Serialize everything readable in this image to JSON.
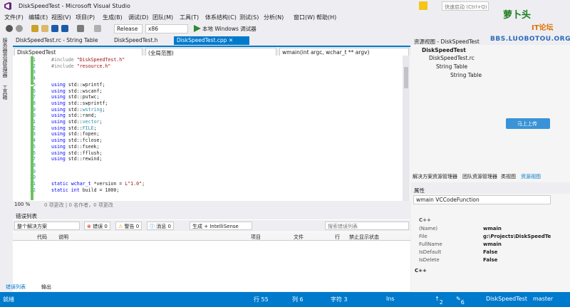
{
  "window": {
    "title": "DiskSpeedTest - Microsoft Visual Studio",
    "quick_launch": "快速启动 (Ctrl+Q)"
  },
  "menu": [
    "文件(F)",
    "编辑(E)",
    "视图(V)",
    "项目(P)",
    "生成(B)",
    "调试(D)",
    "团队(M)",
    "工具(T)",
    "体系结构(C)",
    "测试(S)",
    "分析(N)",
    "窗口(W)",
    "帮助(H)"
  ],
  "toolbar": {
    "config": "Release",
    "platform": "x86",
    "run_label": "本地 Windows 调试器"
  },
  "left_tabs": [
    "服务器资源管理器",
    "工具箱"
  ],
  "doc_tabs": [
    "DiskSpeedTest.rc - String Table",
    "DiskSpeedTest.h",
    "DiskSpeedTest.cpp"
  ],
  "navbar": {
    "project": "DiskSpeedTest",
    "scope": "(全局范围)",
    "member": "wmain(int argc, wchar_t ** argv)"
  },
  "code_lines": [
    {
      "n": "1",
      "parts": [
        {
          "t": "#include ",
          "c": "pp"
        },
        {
          "t": "\"DiskSpeedTest.h\"",
          "c": "str"
        }
      ]
    },
    {
      "n": "2",
      "parts": [
        {
          "t": "#include ",
          "c": "pp"
        },
        {
          "t": "\"resource.h\"",
          "c": "str"
        }
      ]
    },
    {
      "n": "3",
      "parts": []
    },
    {
      "n": "4",
      "parts": []
    },
    {
      "n": "5",
      "parts": [
        {
          "t": "using ",
          "c": "kw"
        },
        {
          "t": "std::wprintf;",
          "c": ""
        }
      ]
    },
    {
      "n": "6",
      "parts": [
        {
          "t": "using ",
          "c": "kw"
        },
        {
          "t": "std::wscanf;",
          "c": ""
        }
      ]
    },
    {
      "n": "7",
      "parts": [
        {
          "t": "using ",
          "c": "kw"
        },
        {
          "t": "std::putwc;",
          "c": ""
        }
      ]
    },
    {
      "n": "8",
      "parts": [
        {
          "t": "using ",
          "c": "kw"
        },
        {
          "t": "std::swprintf;",
          "c": ""
        }
      ]
    },
    {
      "n": "9",
      "parts": [
        {
          "t": "using ",
          "c": "kw"
        },
        {
          "t": "std::",
          "c": ""
        },
        {
          "t": "wstring",
          "c": "ty"
        },
        {
          "t": ";",
          "c": ""
        }
      ]
    },
    {
      "n": "10",
      "parts": [
        {
          "t": "using ",
          "c": "kw"
        },
        {
          "t": "std::rand;",
          "c": ""
        }
      ]
    },
    {
      "n": "11",
      "parts": [
        {
          "t": "using ",
          "c": "kw"
        },
        {
          "t": "std::",
          "c": ""
        },
        {
          "t": "vector",
          "c": "ty"
        },
        {
          "t": ";",
          "c": ""
        }
      ]
    },
    {
      "n": "12",
      "parts": [
        {
          "t": "using ",
          "c": "kw"
        },
        {
          "t": "std::",
          "c": ""
        },
        {
          "t": "FILE",
          "c": "ty"
        },
        {
          "t": ";",
          "c": ""
        }
      ]
    },
    {
      "n": "13",
      "parts": [
        {
          "t": "using ",
          "c": "kw"
        },
        {
          "t": "std::fopen;",
          "c": ""
        }
      ]
    },
    {
      "n": "14",
      "parts": [
        {
          "t": "using ",
          "c": "kw"
        },
        {
          "t": "std::fclose;",
          "c": ""
        }
      ]
    },
    {
      "n": "15",
      "parts": [
        {
          "t": "using ",
          "c": "kw"
        },
        {
          "t": "std::fseek;",
          "c": ""
        }
      ]
    },
    {
      "n": "16",
      "parts": [
        {
          "t": "using ",
          "c": "kw"
        },
        {
          "t": "std::fflush;",
          "c": ""
        }
      ]
    },
    {
      "n": "17",
      "parts": [
        {
          "t": "using ",
          "c": "kw"
        },
        {
          "t": "std::rewind;",
          "c": ""
        }
      ]
    },
    {
      "n": "18",
      "parts": []
    },
    {
      "n": "19",
      "parts": []
    },
    {
      "n": "20",
      "parts": []
    },
    {
      "n": "21",
      "parts": [
        {
          "t": "static ",
          "c": "kw"
        },
        {
          "t": "wchar_t ",
          "c": "kw"
        },
        {
          "t": "*version = ",
          "c": ""
        },
        {
          "t": "L\"1.0\"",
          "c": "str"
        },
        {
          "t": ";",
          "c": ""
        }
      ]
    },
    {
      "n": "22",
      "parts": [
        {
          "t": "static ",
          "c": "kw"
        },
        {
          "t": "int ",
          "c": "kw"
        },
        {
          "t": "build = 1000;",
          "c": ""
        }
      ]
    }
  ],
  "editor_status": {
    "zoom": "100 %",
    "refs": "0 项更改 | 0 名作者，0 项更改"
  },
  "error_list": {
    "title": "错误列表",
    "scope": "整个解决方案",
    "errors": "错误 0",
    "warnings": "警告 0",
    "messages": "消息 0",
    "build_filter": "生成 + IntelliSense",
    "search_placeholder": "搜索错误列表",
    "columns": [
      "代码",
      "说明",
      "项目",
      "文件",
      "行",
      "禁止显示状态"
    ]
  },
  "bottom_tabs": [
    "错误列表",
    "输出"
  ],
  "status": {
    "ready": "就绪",
    "line": "行 55",
    "col": "列 6",
    "char": "字符 3",
    "mode": "Ins",
    "up": "2",
    "edits": "6",
    "repo": "DiskSpeedTest",
    "branch": "master"
  },
  "resource_view": {
    "title": "资源视图 - DiskSpeedTest",
    "tree": [
      "DiskSpeedTest",
      "DiskSpeedTest.rc",
      "String Table",
      "String Table"
    ]
  },
  "right_tabs": [
    "解决方案资源管理器",
    "团队资源管理器",
    "类视图",
    "资源视图"
  ],
  "properties": {
    "title": "属性",
    "object": "wmain  VCCodeFunction",
    "category": "C++",
    "rows": [
      {
        "k": "(Name)",
        "v": "wmain"
      },
      {
        "k": "File",
        "v": "g:\\Projects\\DiskSpeedTes"
      },
      {
        "k": "FullName",
        "v": "wmain"
      },
      {
        "k": "IsDefault",
        "v": "False"
      },
      {
        "k": "IsDelete",
        "v": "False"
      }
    ],
    "footer": "C++"
  },
  "watermark": {
    "name": "萝卜头",
    "sub": "IT论坛",
    "url": "BBS.LUOBOTOU.ORG",
    "button": "马上上传"
  }
}
